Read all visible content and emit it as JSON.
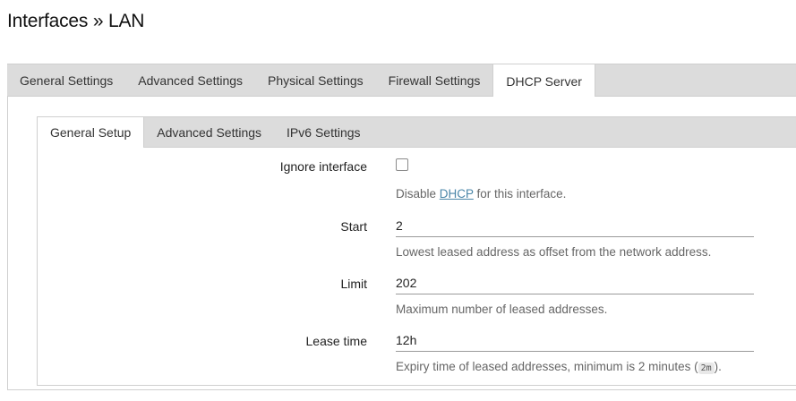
{
  "page": {
    "title": "Interfaces » LAN"
  },
  "main_tabs": [
    {
      "label": "General Settings",
      "active": false
    },
    {
      "label": "Advanced Settings",
      "active": false
    },
    {
      "label": "Physical Settings",
      "active": false
    },
    {
      "label": "Firewall Settings",
      "active": false
    },
    {
      "label": "DHCP Server",
      "active": true
    }
  ],
  "sub_tabs": [
    {
      "label": "General Setup",
      "active": true
    },
    {
      "label": "Advanced Settings",
      "active": false
    },
    {
      "label": "IPv6 Settings",
      "active": false
    }
  ],
  "fields": {
    "ignore": {
      "label": "Ignore interface",
      "checked": false,
      "desc_before": "Disable ",
      "desc_link": "DHCP",
      "desc_after": " for this interface."
    },
    "start": {
      "label": "Start",
      "value": "2",
      "desc": "Lowest leased address as offset from the network address."
    },
    "limit": {
      "label": "Limit",
      "value": "202",
      "desc": "Maximum number of leased addresses."
    },
    "leasetime": {
      "label": "Lease time",
      "value": "12h",
      "desc_before": "Expiry time of leased addresses, minimum is 2 minutes (",
      "desc_code": "2m",
      "desc_after": ")."
    }
  }
}
